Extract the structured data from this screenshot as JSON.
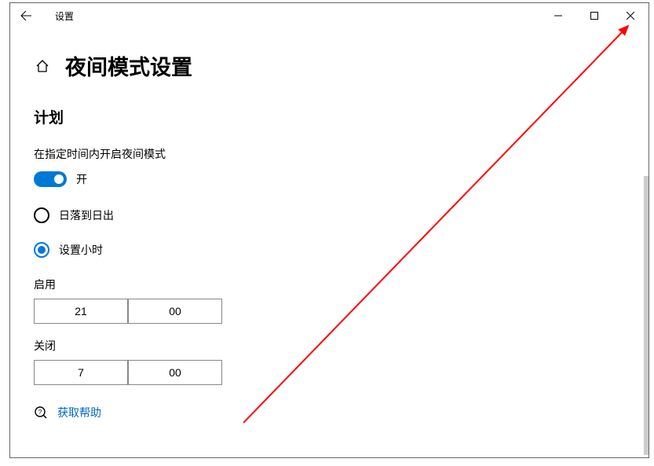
{
  "titlebar": {
    "title": "设置"
  },
  "page": {
    "title": "夜间模式设置"
  },
  "schedule": {
    "heading": "计划",
    "toggle_description": "在指定时间内开启夜间模式",
    "toggle_state_label": "开",
    "option_sunset": "日落到日出",
    "option_hours": "设置小时"
  },
  "turn_on": {
    "label": "启用",
    "hour": "21",
    "minute": "00"
  },
  "turn_off": {
    "label": "关闭",
    "hour": "7",
    "minute": "00"
  },
  "help": {
    "link": "获取帮助"
  }
}
